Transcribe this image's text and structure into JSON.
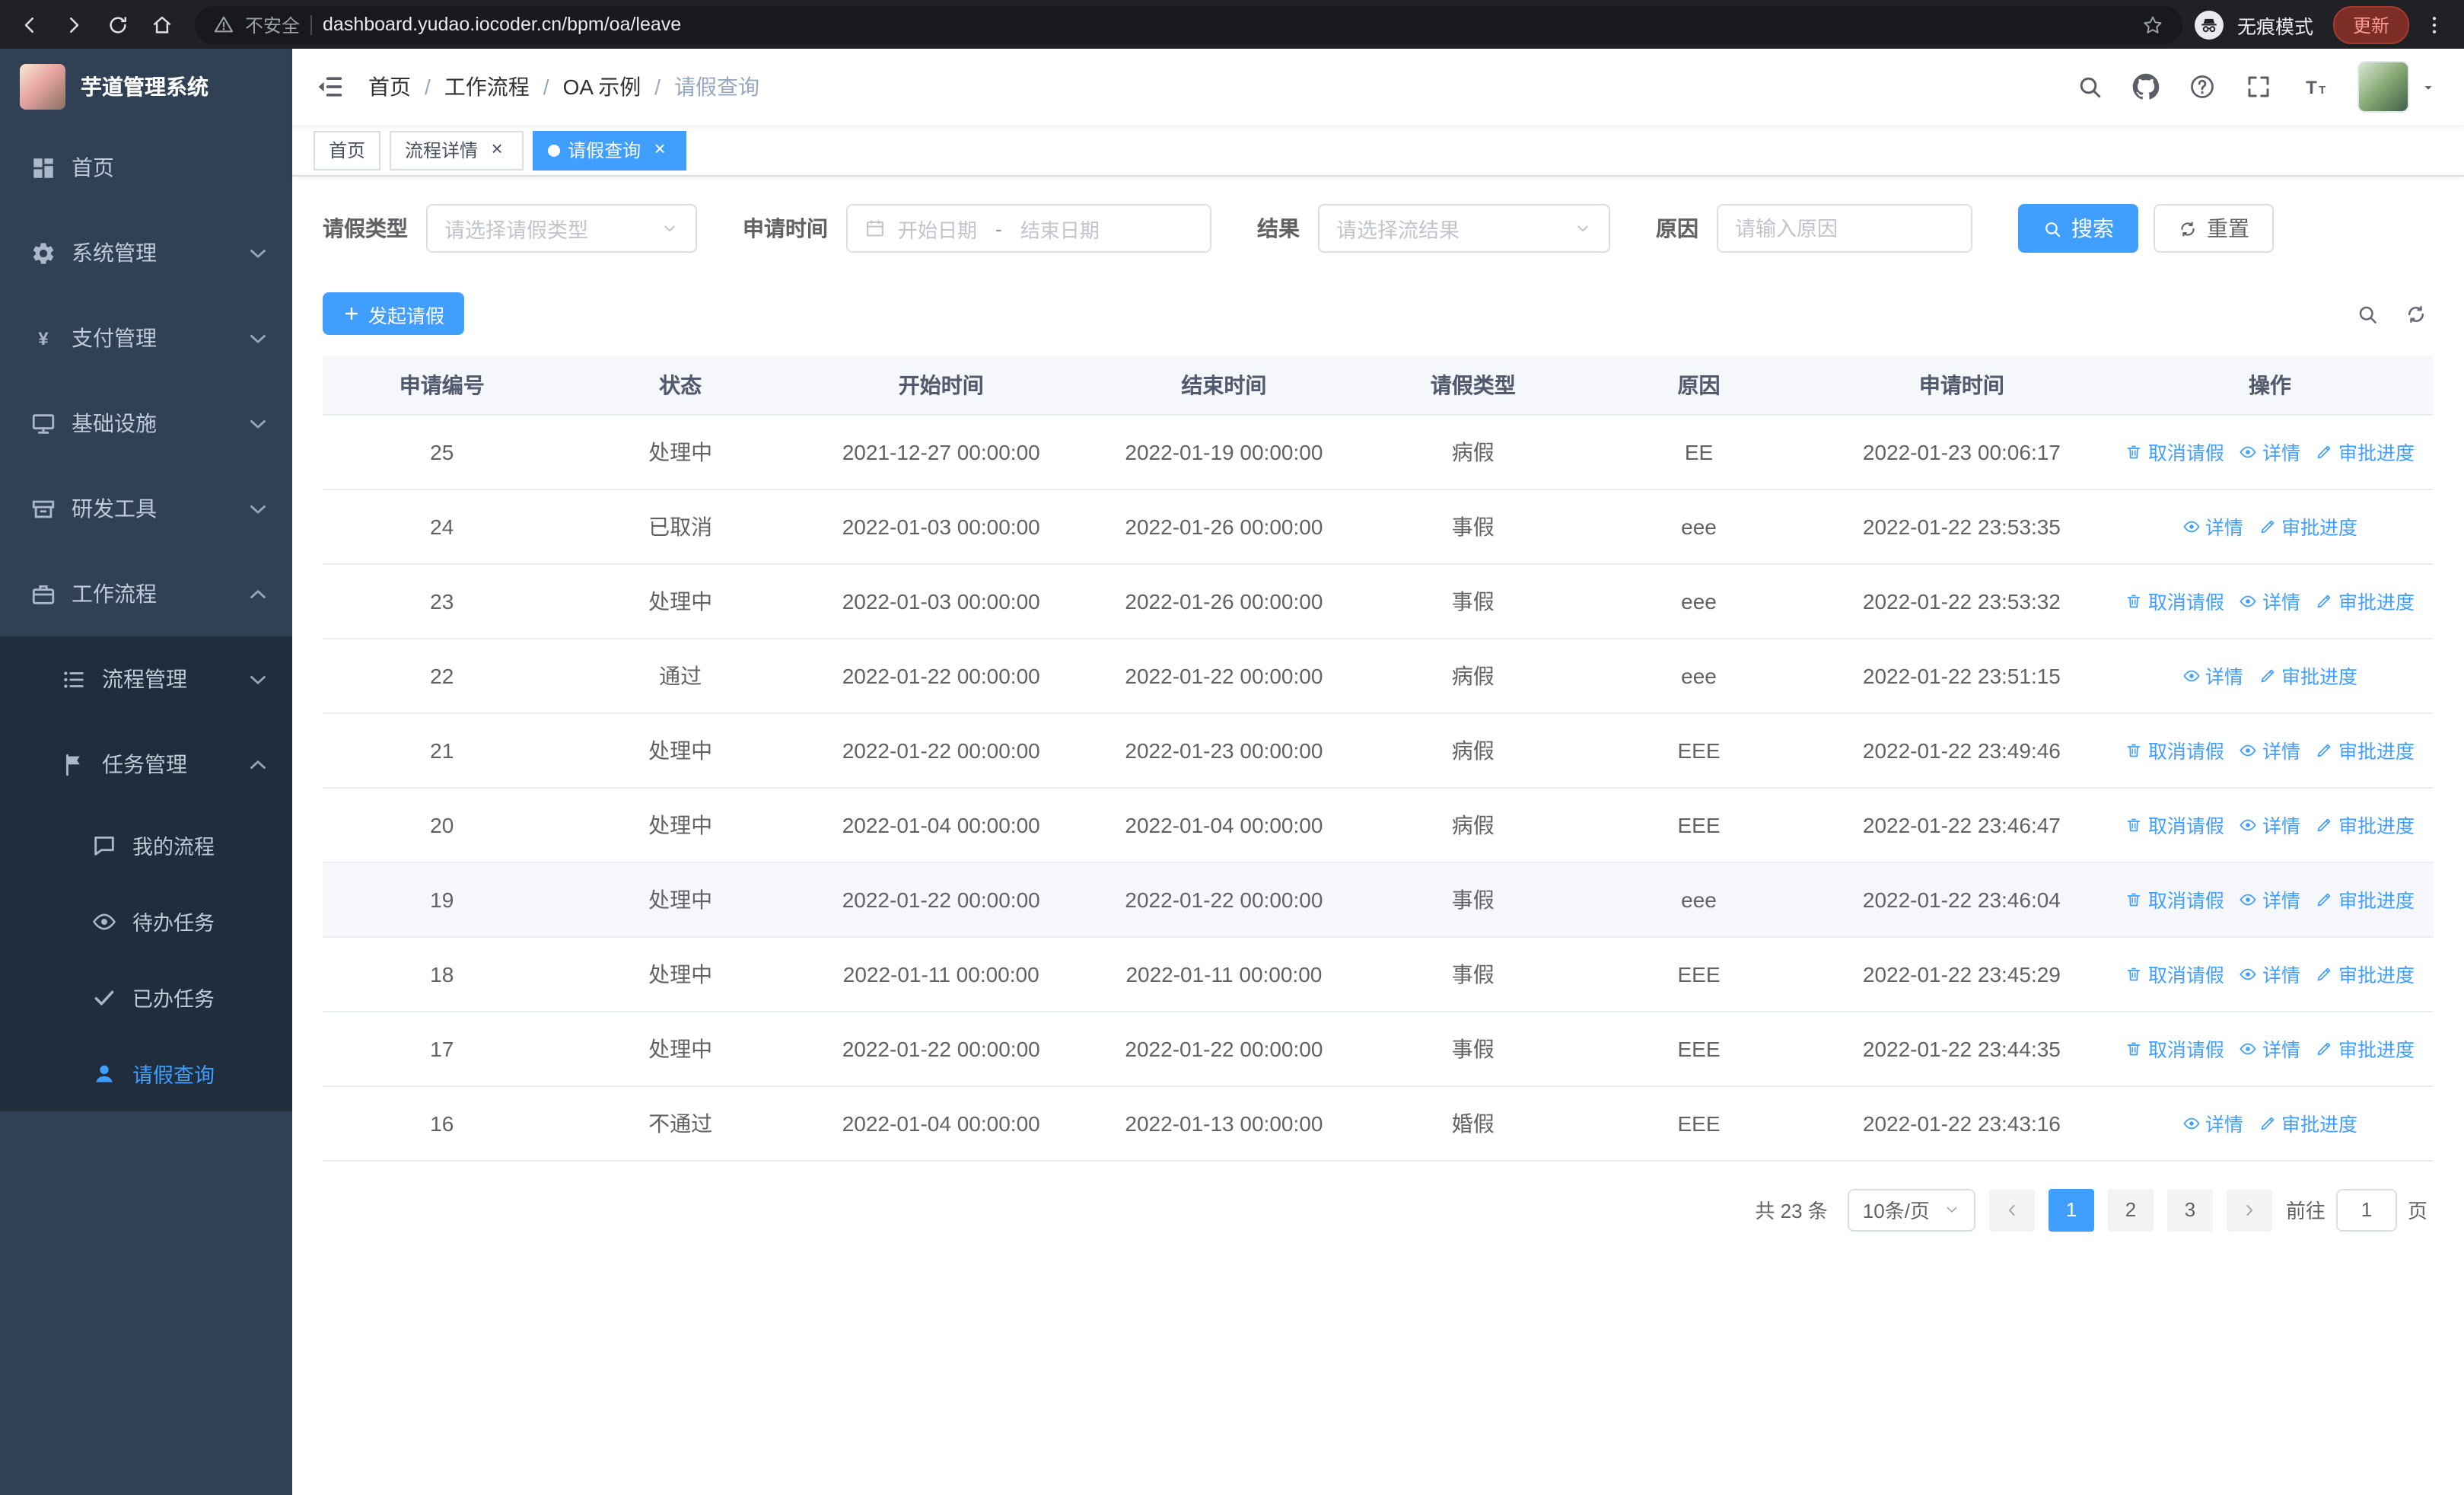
{
  "browser": {
    "security_warning": "不安全",
    "url": "dashboard.yudao.iocoder.cn/bpm/oa/leave",
    "incognito_label": "无痕模式",
    "update_label": "更新"
  },
  "sidebar": {
    "logo_title": "芋道管理系统",
    "menu": [
      {
        "key": "home",
        "label": "首页",
        "icon": "home-icon",
        "level": 0
      },
      {
        "key": "system",
        "label": "系统管理",
        "icon": "gear-icon",
        "level": 0,
        "chevron": "down"
      },
      {
        "key": "payment",
        "label": "支付管理",
        "icon": "yen-icon",
        "level": 0,
        "chevron": "down"
      },
      {
        "key": "infra",
        "label": "基础设施",
        "icon": "monitor-icon",
        "level": 0,
        "chevron": "down"
      },
      {
        "key": "devtools",
        "label": "研发工具",
        "icon": "toolbox-icon",
        "level": 0,
        "chevron": "down"
      },
      {
        "key": "workflow",
        "label": "工作流程",
        "icon": "briefcase-icon",
        "level": 0,
        "chevron": "up"
      },
      {
        "key": "process-mgmt",
        "label": "流程管理",
        "icon": "list-icon",
        "level": 1,
        "chevron": "down",
        "submenu": true
      },
      {
        "key": "task-mgmt",
        "label": "任务管理",
        "icon": "flag-icon",
        "level": 1,
        "chevron": "up",
        "submenu": true
      },
      {
        "key": "my-process",
        "label": "我的流程",
        "icon": "chat-icon",
        "level": 2,
        "submenu": true
      },
      {
        "key": "todo-task",
        "label": "待办任务",
        "icon": "eye-icon",
        "level": 2,
        "submenu": true
      },
      {
        "key": "done-task",
        "label": "已办任务",
        "icon": "check-icon",
        "level": 2,
        "submenu": true
      },
      {
        "key": "leave-query",
        "label": "请假查询",
        "icon": "user-icon",
        "level": 2,
        "submenu": true,
        "active": true
      }
    ]
  },
  "navbar": {
    "breadcrumb": [
      "首页",
      "工作流程",
      "OA 示例",
      "请假查询"
    ]
  },
  "tabs": [
    {
      "key": "home",
      "label": "首页"
    },
    {
      "key": "process-detail",
      "label": "流程详情",
      "closable": true
    },
    {
      "key": "leave-query",
      "label": "请假查询",
      "closable": true,
      "active": true
    }
  ],
  "filters": {
    "leave_type": {
      "label": "请假类型",
      "placeholder": "请选择请假类型"
    },
    "apply_time": {
      "label": "申请时间",
      "start_placeholder": "开始日期",
      "separator": "-",
      "end_placeholder": "结束日期"
    },
    "result": {
      "label": "结果",
      "placeholder": "请选择流结果"
    },
    "reason": {
      "label": "原因",
      "placeholder": "请输入原因"
    },
    "search_label": "搜索",
    "reset_label": "重置"
  },
  "toolbar": {
    "create_label": "发起请假"
  },
  "table": {
    "columns": [
      "申请编号",
      "状态",
      "开始时间",
      "结束时间",
      "请假类型",
      "原因",
      "申请时间",
      "操作"
    ],
    "action_labels": {
      "cancel": "取消请假",
      "detail": "详情",
      "progress": "审批进度"
    },
    "rows": [
      {
        "id": "25",
        "status": "处理中",
        "start": "2021-12-27 00:00:00",
        "end": "2022-01-19 00:00:00",
        "type": "病假",
        "reason": "EE",
        "applied": "2022-01-23 00:06:17",
        "actions": [
          "cancel",
          "detail",
          "progress"
        ]
      },
      {
        "id": "24",
        "status": "已取消",
        "start": "2022-01-03 00:00:00",
        "end": "2022-01-26 00:00:00",
        "type": "事假",
        "reason": "eee",
        "applied": "2022-01-22 23:53:35",
        "actions": [
          "detail",
          "progress"
        ]
      },
      {
        "id": "23",
        "status": "处理中",
        "start": "2022-01-03 00:00:00",
        "end": "2022-01-26 00:00:00",
        "type": "事假",
        "reason": "eee",
        "applied": "2022-01-22 23:53:32",
        "actions": [
          "cancel",
          "detail",
          "progress"
        ]
      },
      {
        "id": "22",
        "status": "通过",
        "start": "2022-01-22 00:00:00",
        "end": "2022-01-22 00:00:00",
        "type": "病假",
        "reason": "eee",
        "applied": "2022-01-22 23:51:15",
        "actions": [
          "detail",
          "progress"
        ]
      },
      {
        "id": "21",
        "status": "处理中",
        "start": "2022-01-22 00:00:00",
        "end": "2022-01-23 00:00:00",
        "type": "病假",
        "reason": "EEE",
        "applied": "2022-01-22 23:49:46",
        "actions": [
          "cancel",
          "detail",
          "progress"
        ]
      },
      {
        "id": "20",
        "status": "处理中",
        "start": "2022-01-04 00:00:00",
        "end": "2022-01-04 00:00:00",
        "type": "病假",
        "reason": "EEE",
        "applied": "2022-01-22 23:46:47",
        "actions": [
          "cancel",
          "detail",
          "progress"
        ]
      },
      {
        "id": "19",
        "status": "处理中",
        "start": "2022-01-22 00:00:00",
        "end": "2022-01-22 00:00:00",
        "type": "事假",
        "reason": "eee",
        "applied": "2022-01-22 23:46:04",
        "actions": [
          "cancel",
          "detail",
          "progress"
        ],
        "highlight": true
      },
      {
        "id": "18",
        "status": "处理中",
        "start": "2022-01-11 00:00:00",
        "end": "2022-01-11 00:00:00",
        "type": "事假",
        "reason": "EEE",
        "applied": "2022-01-22 23:45:29",
        "actions": [
          "cancel",
          "detail",
          "progress"
        ]
      },
      {
        "id": "17",
        "status": "处理中",
        "start": "2022-01-22 00:00:00",
        "end": "2022-01-22 00:00:00",
        "type": "事假",
        "reason": "EEE",
        "applied": "2022-01-22 23:44:35",
        "actions": [
          "cancel",
          "detail",
          "progress"
        ]
      },
      {
        "id": "16",
        "status": "不通过",
        "start": "2022-01-04 00:00:00",
        "end": "2022-01-13 00:00:00",
        "type": "婚假",
        "reason": "EEE",
        "applied": "2022-01-22 23:43:16",
        "actions": [
          "detail",
          "progress"
        ]
      }
    ]
  },
  "pagination": {
    "total_label": "共 23 条",
    "page_size": "10条/页",
    "pages": [
      "1",
      "2",
      "3"
    ],
    "active_page": "1",
    "goto_label": "前往",
    "goto_value": "1",
    "goto_suffix": "页"
  },
  "colors": {
    "primary": "#409eff",
    "sidebar_bg": "#304156",
    "submenu_bg": "#1f2d3d"
  }
}
